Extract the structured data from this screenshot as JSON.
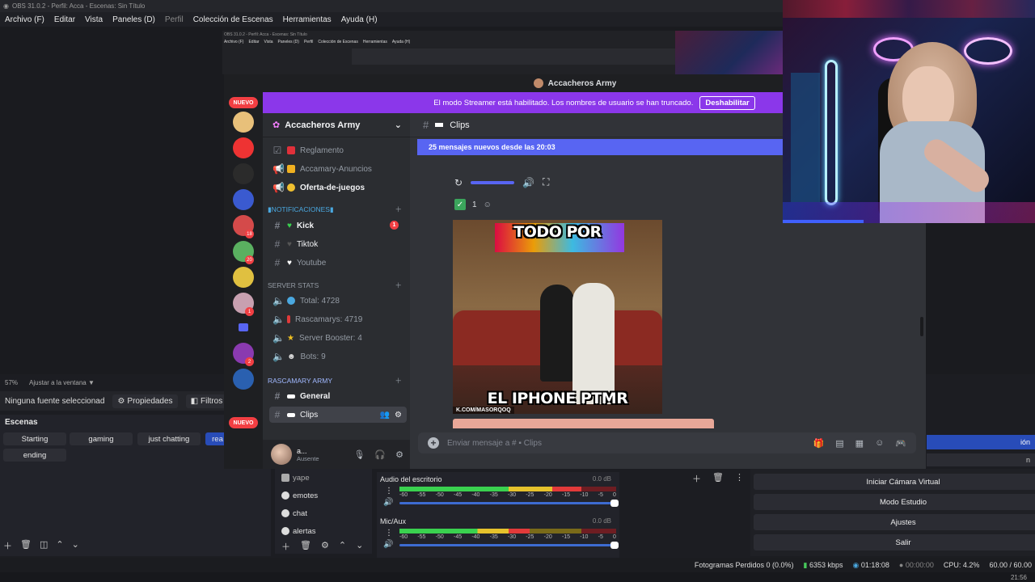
{
  "obs": {
    "title": "OBS 31.0.2 - Perfil: Acca - Escenas: Sin Título",
    "menu": [
      "Archivo (F)",
      "Editar",
      "Vista",
      "Paneles (D)",
      "Perfil",
      "Colección de Escenas",
      "Herramientas",
      "Ayuda (H)"
    ],
    "zoom": "57%",
    "fit_label": "Ajustar a la ventana",
    "no_source": "Ninguna fuente seleccionad",
    "properties_label": "Propiedades",
    "filters_label": "Filtros",
    "scenes_title": "Escenas",
    "scenes": [
      "Starting",
      "gaming",
      "just chatting",
      "rea",
      "ending"
    ],
    "sources": [
      "yape",
      "emotes",
      "chat",
      "alertas"
    ],
    "mixer": {
      "channels": [
        {
          "name": "Audio del escritorio",
          "db": "0.0 dB",
          "level": 0.84
        },
        {
          "name": "Mic/Aux",
          "db": "0.0 dB",
          "level": 0.6
        }
      ],
      "ticks": [
        "-60",
        "-55",
        "-50",
        "-45",
        "-40",
        "-35",
        "-30",
        "-25",
        "-20",
        "-15",
        "-10",
        "-5",
        "0"
      ]
    },
    "controls": {
      "stream": "ión",
      "record": "n",
      "virtual_cam": "Iniciar Cámara Virtual",
      "studio": "Modo Estudio",
      "settings": "Ajustes",
      "exit": "Salir"
    },
    "status": {
      "dropped": "Fotogramas Perdidos 0 (0.0%)",
      "bitrate": "6353 kbps",
      "live_time": "01:18:08",
      "rec_time": "00:00:00",
      "cpu": "CPU: 4.2%",
      "fps": "60.00 / 60.00"
    },
    "clock": "21:56"
  },
  "nested": {
    "title": "OBS 31.0.2 - Perfil: Acca - Escenas: Sin Título",
    "menu": [
      "Archivo (F)",
      "Editar",
      "Vista",
      "Paneles (D)",
      "Perfil",
      "Colección de Escenas",
      "Herramientas",
      "Ayuda (H)"
    ]
  },
  "discord": {
    "window_title": "Accacheros Army",
    "banner_text": "El modo Streamer está habilitado. Los nombres de usuario se han truncado.",
    "banner_button": "Deshabilitar",
    "nuevo_label": "NUEVO",
    "server_badges": [
      "18",
      "20",
      "1",
      "2"
    ],
    "server_name": "Accacheros Army",
    "channels_top": [
      {
        "name": "Reglamento",
        "emoji_color": "#e0303a"
      },
      {
        "name": "Accamary-Anuncios",
        "emoji_color": "#f0b020"
      },
      {
        "name": "Oferta-de-juegos",
        "emoji_color": "#f0c030"
      }
    ],
    "cat_notifications": "▮NOTIFICACIONES▮",
    "notif_channels": [
      {
        "name": "Kick",
        "emoji_color": "#3ad14f",
        "badge": "1"
      },
      {
        "name": "Tiktok",
        "emoji_color": "#222222"
      },
      {
        "name": "Youtube",
        "emoji_color": "#ffffff"
      }
    ],
    "cat_stats": "SERVER STATS",
    "stats": [
      {
        "name": "Total: 4728",
        "emoji_color": "#4aa8e0"
      },
      {
        "name": "Rascamarys: 4719",
        "emoji_color": "#e03a3a"
      },
      {
        "name": "Server Booster: 4",
        "emoji_color": "#f0c020"
      },
      {
        "name": "Bots: 9",
        "emoji_color": "#dddddd"
      }
    ],
    "cat_army": "RASCAMARY ARMY",
    "army_channels": [
      {
        "name": "General"
      },
      {
        "name": "Clips"
      }
    ],
    "user": {
      "name": "a...",
      "status": "Ausente"
    },
    "chat_channel": "Clips",
    "new_messages": "25 mensajes nuevos desde las 20:03",
    "reaction_count": "1",
    "meme_top": "TODO POR",
    "meme_bottom": "EL IPHONE PTMR",
    "meme_watermark": "K.COM/MASORQOQ",
    "composer_placeholder": "Enviar mensaje a #",
    "composer_channel": "Clips"
  }
}
